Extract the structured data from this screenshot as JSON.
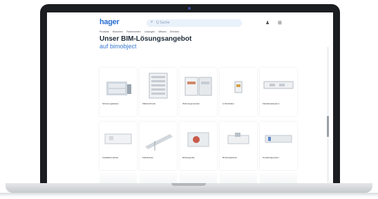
{
  "header": {
    "logo": "hager",
    "search_placeholder": "Q Suche",
    "user_icon": "user-icon",
    "cart_icon": "cart-icon"
  },
  "nav": [
    "Produkte",
    "Branchen",
    "Partnerseiten",
    "Lösungen",
    "Wissen",
    "Services"
  ],
  "page": {
    "title": "Unser BIM-Lösungsangebot",
    "subtitle": "auf bimobject"
  },
  "cards_row1": [
    {
      "label": "Sicherungskasten",
      "icon": "switchboard-icon"
    },
    {
      "label": "Zählerschrank",
      "icon": "meter-cabinet-icon"
    },
    {
      "label": "Wohnungsverteiler",
      "icon": "distribution-board-icon"
    },
    {
      "label": "Lichtschalter",
      "icon": "switch-icon"
    },
    {
      "label": "Kabelkanalsystem",
      "icon": "cable-trunking-icon"
    }
  ],
  "cards_row2": [
    {
      "label": "Installationskanal",
      "icon": "installation-duct-icon"
    },
    {
      "label": "Kabeltrasse",
      "icon": "cable-tray-icon"
    },
    {
      "label": "Einbaugeräte",
      "icon": "device-icon"
    },
    {
      "label": "Brüstungskanal",
      "icon": "parapet-duct-icon"
    },
    {
      "label": "Gerätetragsystem",
      "icon": "support-system-icon"
    }
  ]
}
